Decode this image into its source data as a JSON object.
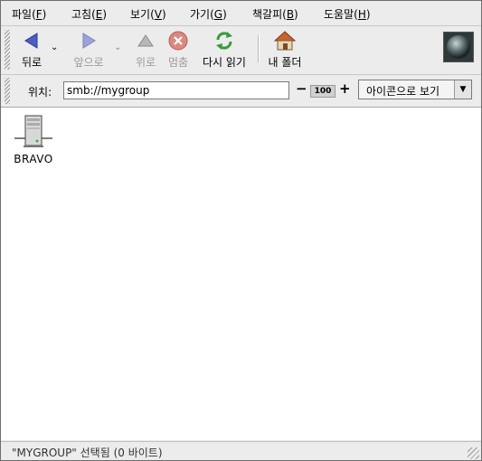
{
  "menubar": {
    "items": [
      {
        "label": "파일(",
        "key": "F",
        "end": ")"
      },
      {
        "label": "고침(",
        "key": "E",
        "end": ")"
      },
      {
        "label": "보기(",
        "key": "V",
        "end": ")"
      },
      {
        "label": "가기(",
        "key": "G",
        "end": ")"
      },
      {
        "label": "책갈피(",
        "key": "B",
        "end": ")"
      },
      {
        "label": "도움말(",
        "key": "H",
        "end": ")"
      }
    ]
  },
  "toolbar": {
    "back": "뒤로",
    "forward": "앞으로",
    "up": "위로",
    "stop": "멈춤",
    "reload": "다시 읽기",
    "home": "내 폴더"
  },
  "location": {
    "label": "위치:",
    "value": "smb://mygroup",
    "zoom": "100",
    "view_mode": "아이콘으로 보기"
  },
  "files": [
    {
      "name": "BRAVO",
      "icon": "server-icon"
    }
  ],
  "status": {
    "text": "\"MYGROUP\" 선택됨 (0 바이트)"
  },
  "colors": {
    "arrow_blue": "#4a5ec8",
    "home_orange": "#c9642a",
    "stop_red": "#c23a2a",
    "reload_green": "#3a9a3a"
  }
}
